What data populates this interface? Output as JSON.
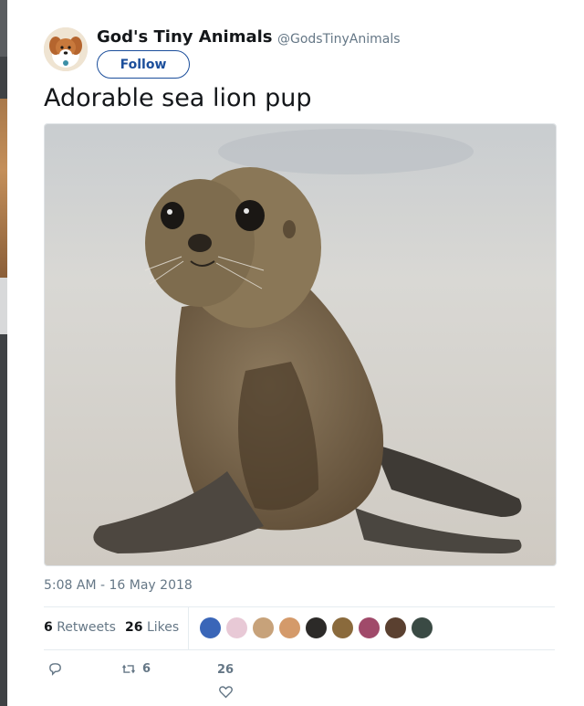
{
  "tweet": {
    "display_name": "God's Tiny Animals",
    "screen_name": "@GodsTinyAnimals",
    "follow_label": "Follow",
    "text": "Adorable sea lion pup",
    "timestamp": "5:08 AM - 16 May 2018",
    "media_description": "sea lion pup photo"
  },
  "stats": {
    "retweets_count": "6",
    "retweets_label": "Retweets",
    "likes_count": "26",
    "likes_label": "Likes"
  },
  "actions": {
    "reply_icon": "reply-icon",
    "retweet_icon": "retweet-icon",
    "retweet_count": "6",
    "like_icon": "heart-icon",
    "like_count": "26"
  },
  "colors": {
    "accent": "#1b4e9b",
    "secondary_text": "#657786",
    "divider": "#e6ecf0"
  },
  "liker_avatars": [
    {
      "color": "#3a66b8"
    },
    {
      "color": "#e8c9d6"
    },
    {
      "color": "#c7a27a"
    },
    {
      "color": "#d49a6a"
    },
    {
      "color": "#2c2a28"
    },
    {
      "color": "#8a6a3c"
    },
    {
      "color": "#a04a6a"
    },
    {
      "color": "#5a4030"
    },
    {
      "color": "#3a4a44"
    }
  ]
}
